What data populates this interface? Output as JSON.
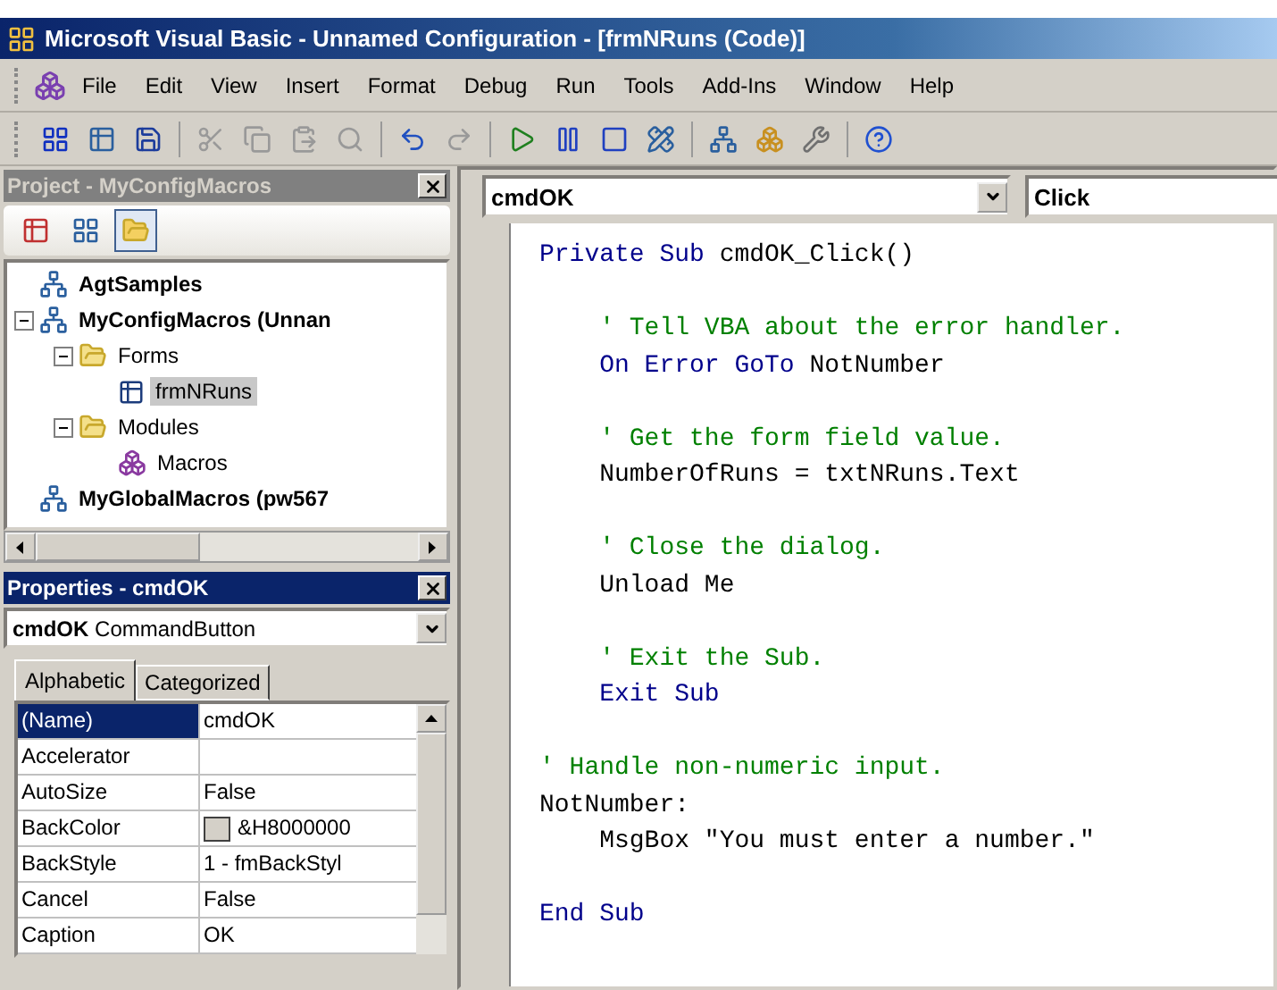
{
  "window": {
    "title": "Microsoft Visual Basic - Unnamed Configuration - [frmNRuns (Code)]"
  },
  "menu": [
    "File",
    "Edit",
    "View",
    "Insert",
    "Format",
    "Debug",
    "Run",
    "Tools",
    "Add-Ins",
    "Window",
    "Help"
  ],
  "project": {
    "title": "Project - MyConfigMacros",
    "tree": [
      {
        "label": "AgtSamples",
        "kind": "project",
        "selected": false
      },
      {
        "label": "MyConfigMacros (Unnan",
        "kind": "project",
        "selected": false,
        "expanded": true,
        "children": [
          {
            "label": "Forms",
            "kind": "folder",
            "selected": false,
            "expanded": true,
            "children": [
              {
                "label": "frmNRuns",
                "kind": "form",
                "selected": true
              }
            ]
          },
          {
            "label": "Modules",
            "kind": "folder",
            "selected": false,
            "expanded": true,
            "children": [
              {
                "label": "Macros",
                "kind": "module",
                "selected": false
              }
            ]
          }
        ]
      },
      {
        "label": "MyGlobalMacros (pw567",
        "kind": "project",
        "selected": false
      }
    ]
  },
  "properties": {
    "title": "Properties - cmdOK",
    "object_name": "cmdOK",
    "object_type": "CommandButton",
    "tabs": [
      {
        "label": "Alphabetic",
        "selected": true
      },
      {
        "label": "Categorized",
        "selected": false
      }
    ],
    "rows": [
      {
        "name": "(Name)",
        "value": "cmdOK",
        "kind": "text",
        "selected": true
      },
      {
        "name": "Accelerator",
        "kind": "text",
        "selected": false
      },
      {
        "name": "AutoSize",
        "value": "False",
        "kind": "text",
        "selected": false
      },
      {
        "name": "BackColor",
        "value": "&H8000000",
        "kind": "color",
        "selected": false
      },
      {
        "name": "BackStyle",
        "value": "1 - fmBackStyl",
        "kind": "text",
        "selected": false
      },
      {
        "name": "Cancel",
        "value": "False",
        "kind": "text",
        "selected": false
      },
      {
        "name": "Caption",
        "value": "OK",
        "kind": "text",
        "selected": false
      }
    ]
  },
  "code": {
    "object": "cmdOK",
    "procedure": "Click",
    "lines": [
      {
        "kind": "code",
        "segments": [
          {
            "kind": "keyword",
            "text": "Private Sub"
          },
          {
            "kind": "plain",
            "text": " cmdOK_Click()"
          }
        ]
      },
      {
        "kind": "blank"
      },
      {
        "kind": "code",
        "segments": [
          {
            "kind": "comment",
            "text": "    ' Tell VBA about the error handler."
          }
        ]
      },
      {
        "kind": "code",
        "segments": [
          {
            "kind": "keyword",
            "text": "    On Error GoTo"
          },
          {
            "kind": "plain",
            "text": " NotNumber"
          }
        ]
      },
      {
        "kind": "blank"
      },
      {
        "kind": "code",
        "segments": [
          {
            "kind": "comment",
            "text": "    ' Get the form field value."
          }
        ]
      },
      {
        "kind": "code",
        "segments": [
          {
            "kind": "plain",
            "text": "    NumberOfRuns = txtNRuns.Text"
          }
        ]
      },
      {
        "kind": "blank"
      },
      {
        "kind": "code",
        "segments": [
          {
            "kind": "comment",
            "text": "    ' Close the dialog."
          }
        ]
      },
      {
        "kind": "code",
        "segments": [
          {
            "kind": "plain",
            "text": "    Unload Me"
          }
        ]
      },
      {
        "kind": "blank"
      },
      {
        "kind": "code",
        "segments": [
          {
            "kind": "comment",
            "text": "    ' Exit the Sub."
          }
        ]
      },
      {
        "kind": "code",
        "segments": [
          {
            "kind": "keyword",
            "text": "    Exit Sub"
          }
        ]
      },
      {
        "kind": "blank"
      },
      {
        "kind": "code",
        "segments": [
          {
            "kind": "comment",
            "text": "' Handle non-numeric input."
          }
        ]
      },
      {
        "kind": "code",
        "segments": [
          {
            "kind": "plain",
            "text": "NotNumber:"
          }
        ]
      },
      {
        "kind": "code",
        "segments": [
          {
            "kind": "plain",
            "text": "    MsgBox \"You must enter a number.\""
          }
        ]
      },
      {
        "kind": "blank"
      },
      {
        "kind": "code",
        "segments": [
          {
            "kind": "keyword",
            "text": "End Sub"
          }
        ]
      }
    ]
  }
}
